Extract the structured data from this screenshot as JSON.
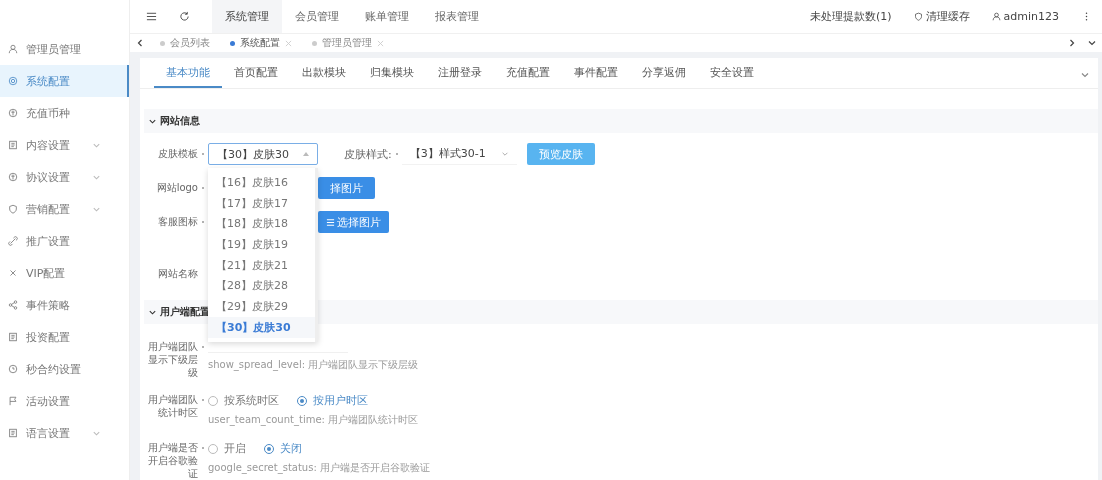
{
  "sidebar": {
    "items": [
      {
        "label": "管理员管理",
        "selected": false,
        "expandable": false
      },
      {
        "label": "系统配置",
        "selected": true,
        "expandable": false
      },
      {
        "label": "充值币种",
        "selected": false,
        "expandable": false
      },
      {
        "label": "内容设置",
        "selected": false,
        "expandable": true
      },
      {
        "label": "协议设置",
        "selected": false,
        "expandable": true
      },
      {
        "label": "营销配置",
        "selected": false,
        "expandable": true
      },
      {
        "label": "推广设置",
        "selected": false,
        "expandable": false
      },
      {
        "label": "VIP配置",
        "selected": false,
        "expandable": false
      },
      {
        "label": "事件策略",
        "selected": false,
        "expandable": false
      },
      {
        "label": "投资配置",
        "selected": false,
        "expandable": false
      },
      {
        "label": "秒合约设置",
        "selected": false,
        "expandable": false
      },
      {
        "label": "活动设置",
        "selected": false,
        "expandable": false
      },
      {
        "label": "语言设置",
        "selected": false,
        "expandable": true
      }
    ]
  },
  "topbar": {
    "nav": [
      {
        "label": "系统管理",
        "selected": true
      },
      {
        "label": "会员管理",
        "selected": false
      },
      {
        "label": "账单管理",
        "selected": false
      },
      {
        "label": "报表管理",
        "selected": false
      }
    ],
    "withdraw_notice": "未处理提款数(1)",
    "clear_cache": "清理缓存",
    "user": "admin123"
  },
  "tag_bar": {
    "tags": [
      {
        "label": "会员列表",
        "selected": false,
        "closable": false
      },
      {
        "label": "系统配置",
        "selected": true,
        "closable": true
      },
      {
        "label": "管理员管理",
        "selected": false,
        "closable": true
      }
    ]
  },
  "tabs": [
    {
      "label": "基本功能",
      "selected": true
    },
    {
      "label": "首页配置",
      "selected": false
    },
    {
      "label": "出款模块",
      "selected": false
    },
    {
      "label": "归集模块",
      "selected": false
    },
    {
      "label": "注册登录",
      "selected": false
    },
    {
      "label": "充值配置",
      "selected": false
    },
    {
      "label": "事件配置",
      "selected": false
    },
    {
      "label": "分享返佣",
      "selected": false
    },
    {
      "label": "安全设置",
      "selected": false
    }
  ],
  "sections": [
    {
      "title": "网站信息",
      "expanded": true,
      "rows": [
        {
          "kind": "skin",
          "label": "皮肤模板",
          "required": true,
          "select": "【30】皮肤30",
          "style_label": "皮肤样式:",
          "style_select": "【3】样式30-1",
          "button": "预览皮肤"
        },
        {
          "kind": "image",
          "label": "网站logo",
          "required": true,
          "button": "择图片",
          "button_icon": false
        },
        {
          "kind": "image",
          "label": "客服图标",
          "required": true,
          "button": "选择图片",
          "button_icon": true
        },
        {
          "kind": "text",
          "label": "网站名称",
          "required": false
        }
      ]
    },
    {
      "title": "用户端配置",
      "expanded": true,
      "rows": [
        {
          "kind": "field",
          "label": "用户端团队显示下级层级",
          "required": true,
          "hint": "show_spread_level: 用户端团队显示下级层级"
        },
        {
          "kind": "radio",
          "label": "用户端团队统计时区",
          "required": true,
          "options": [
            {
              "label": "按系统时区",
              "selected": false
            },
            {
              "label": "按用户时区",
              "selected": true
            }
          ],
          "hint": "user_team_count_time: 用户端团队统计时区"
        },
        {
          "kind": "radio",
          "label": "用户端是否开启谷歌验证",
          "required": true,
          "options": [
            {
              "label": "开启",
              "selected": false
            },
            {
              "label": "关闭",
              "selected": true
            }
          ],
          "hint": "google_secret_status: 用户端是否开启谷歌验证"
        }
      ]
    }
  ],
  "dropdown": {
    "options": [
      {
        "label": "【16】皮肤16",
        "selected": false
      },
      {
        "label": "【17】皮肤17",
        "selected": false
      },
      {
        "label": "【18】皮肤18",
        "selected": false
      },
      {
        "label": "【19】皮肤19",
        "selected": false
      },
      {
        "label": "【21】皮肤21",
        "selected": false
      },
      {
        "label": "【28】皮肤28",
        "selected": false
      },
      {
        "label": "【29】皮肤29",
        "selected": false
      },
      {
        "label": "【30】皮肤30",
        "selected": true
      }
    ]
  }
}
